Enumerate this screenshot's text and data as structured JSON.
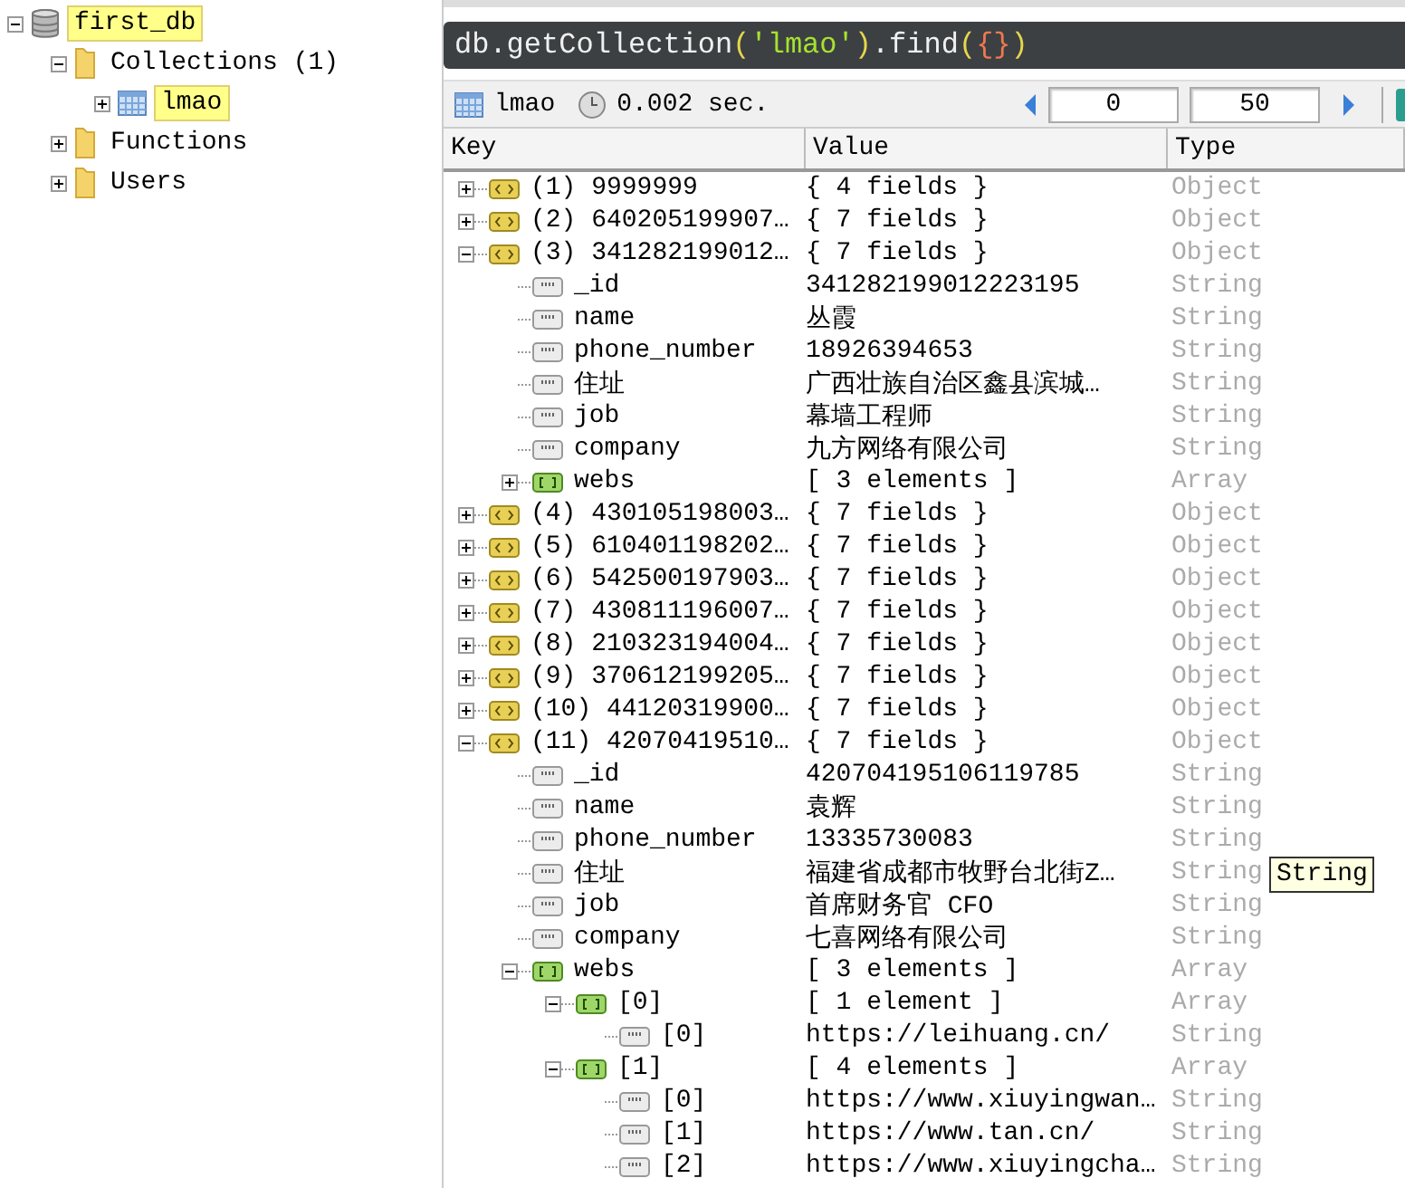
{
  "sidebar": {
    "items": [
      {
        "label": "first_db",
        "kind": "database",
        "expanded": true,
        "selected": true,
        "children": [
          {
            "label": "Collections (1)",
            "kind": "folder",
            "expanded": true,
            "selected": false,
            "children": [
              {
                "label": "lmao",
                "kind": "collection",
                "expanded": false,
                "selected": true
              }
            ]
          },
          {
            "label": "Functions",
            "kind": "folder",
            "expanded": false,
            "selected": false
          },
          {
            "label": "Users",
            "kind": "folder",
            "expanded": false,
            "selected": false
          }
        ]
      }
    ]
  },
  "query": {
    "tokens": [
      {
        "text": "db.getCollection",
        "kind": "plain"
      },
      {
        "text": "(",
        "kind": "paren"
      },
      {
        "text": "'lmao'",
        "kind": "string"
      },
      {
        "text": ")",
        "kind": "paren"
      },
      {
        "text": ".find",
        "kind": "plain"
      },
      {
        "text": "(",
        "kind": "paren"
      },
      {
        "text": "{}",
        "kind": "brace"
      },
      {
        "text": ")",
        "kind": "paren"
      }
    ]
  },
  "toolbar": {
    "collection": "lmao",
    "time": "0.002 sec.",
    "skip": "0",
    "limit": "50"
  },
  "table": {
    "columns": [
      "Key",
      "Value",
      "Type"
    ],
    "rows": [
      {
        "key": "(1) 9999999",
        "value": "{ 4 fields }",
        "type": "Object",
        "kind": "object",
        "expanded": false
      },
      {
        "key": "(2) 640205199907…",
        "value": "{ 7 fields }",
        "type": "Object",
        "kind": "object",
        "expanded": false
      },
      {
        "key": "(3) 341282199012…",
        "value": "{ 7 fields }",
        "type": "Object",
        "kind": "object",
        "expanded": true,
        "children": [
          {
            "key": "_id",
            "value": "341282199012223195",
            "type": "String",
            "kind": "string"
          },
          {
            "key": "name",
            "value": "丛霞",
            "type": "String",
            "kind": "string"
          },
          {
            "key": "phone_number",
            "value": "18926394653",
            "type": "String",
            "kind": "string"
          },
          {
            "key": "住址",
            "value": "广西壮族自治区鑫县滨城…",
            "type": "String",
            "kind": "string"
          },
          {
            "key": "job",
            "value": "幕墙工程师",
            "type": "String",
            "kind": "string"
          },
          {
            "key": "company",
            "value": "九方网络有限公司",
            "type": "String",
            "kind": "string"
          },
          {
            "key": "webs",
            "value": "[ 3 elements ]",
            "type": "Array",
            "kind": "array",
            "expanded": false
          }
        ]
      },
      {
        "key": "(4) 430105198003…",
        "value": "{ 7 fields }",
        "type": "Object",
        "kind": "object",
        "expanded": false
      },
      {
        "key": "(5) 610401198202…",
        "value": "{ 7 fields }",
        "type": "Object",
        "kind": "object",
        "expanded": false
      },
      {
        "key": "(6) 542500197903…",
        "value": "{ 7 fields }",
        "type": "Object",
        "kind": "object",
        "expanded": false
      },
      {
        "key": "(7) 430811196007…",
        "value": "{ 7 fields }",
        "type": "Object",
        "kind": "object",
        "expanded": false
      },
      {
        "key": "(8) 210323194004…",
        "value": "{ 7 fields }",
        "type": "Object",
        "kind": "object",
        "expanded": false
      },
      {
        "key": "(9) 370612199205…",
        "value": "{ 7 fields }",
        "type": "Object",
        "kind": "object",
        "expanded": false
      },
      {
        "key": "(10) 44120319900…",
        "value": "{ 7 fields }",
        "type": "Object",
        "kind": "object",
        "expanded": false
      },
      {
        "key": "(11) 42070419510…",
        "value": "{ 7 fields }",
        "type": "Object",
        "kind": "object",
        "expanded": true,
        "children": [
          {
            "key": "_id",
            "value": "420704195106119785",
            "type": "String",
            "kind": "string"
          },
          {
            "key": "name",
            "value": "袁辉",
            "type": "String",
            "kind": "string"
          },
          {
            "key": "phone_number",
            "value": "13335730083",
            "type": "String",
            "kind": "string"
          },
          {
            "key": "住址",
            "value": "福建省成都市牧野台北街Z…",
            "type": "String",
            "kind": "string"
          },
          {
            "key": "job",
            "value": "首席财务官 CFO",
            "type": "String",
            "kind": "string"
          },
          {
            "key": "company",
            "value": "七喜网络有限公司",
            "type": "String",
            "kind": "string"
          },
          {
            "key": "webs",
            "value": "[ 3 elements ]",
            "type": "Array",
            "kind": "array",
            "expanded": true,
            "children": [
              {
                "key": "[0]",
                "value": "[ 1 element ]",
                "type": "Array",
                "kind": "array",
                "expanded": true,
                "children": [
                  {
                    "key": "[0]",
                    "value": "https://leihuang.cn/",
                    "type": "String",
                    "kind": "string"
                  }
                ]
              },
              {
                "key": "[1]",
                "value": "[ 4 elements ]",
                "type": "Array",
                "kind": "array",
                "expanded": true,
                "children": [
                  {
                    "key": "[0]",
                    "value": "https://www.xiuyingwan…",
                    "type": "String",
                    "kind": "string"
                  },
                  {
                    "key": "[1]",
                    "value": "https://www.tan.cn/",
                    "type": "String",
                    "kind": "string"
                  },
                  {
                    "key": "[2]",
                    "value": "https://www.xiuyingcha…",
                    "type": "String",
                    "kind": "string"
                  }
                ]
              }
            ]
          }
        ]
      }
    ]
  },
  "tooltip": {
    "text": "String"
  }
}
